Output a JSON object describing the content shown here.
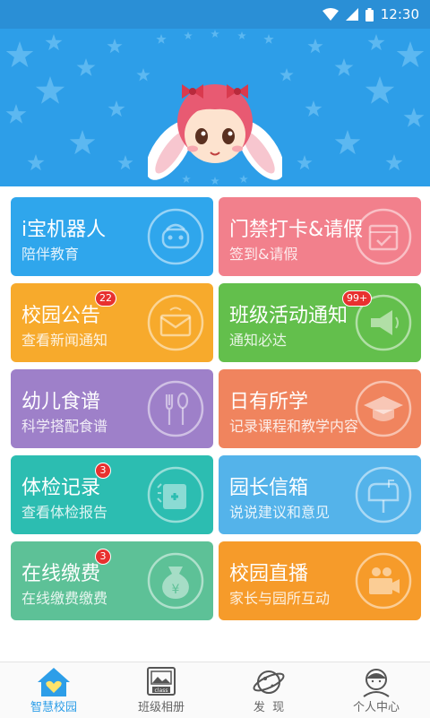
{
  "status_bar": {
    "time": "12:30"
  },
  "tiles": [
    {
      "title": "i宝机器人",
      "subtitle": "陪伴教育",
      "color": "#2fa6ec",
      "icon": "robot-icon",
      "badge": ""
    },
    {
      "title": "门禁打卡&请假",
      "subtitle": "签到&请假",
      "color": "#f2808c",
      "icon": "calendar-check-icon",
      "badge": ""
    },
    {
      "title": "校园公告",
      "subtitle": "查看新闻通知",
      "color": "#f7aa2c",
      "icon": "envelope-icon",
      "badge": "22"
    },
    {
      "title": "班级活动通知",
      "subtitle": "通知必达",
      "color": "#63bf4c",
      "icon": "megaphone-icon",
      "badge": "99+"
    },
    {
      "title": "幼儿食谱",
      "subtitle": "科学搭配食谱",
      "color": "#9e80c9",
      "icon": "fork-spoon-icon",
      "badge": ""
    },
    {
      "title": "日有所学",
      "subtitle": "记录课程和教学内容",
      "color": "#f0845e",
      "icon": "graduation-cap-icon",
      "badge": ""
    },
    {
      "title": "体检记录",
      "subtitle": "查看体检报告",
      "color": "#2cbdb1",
      "icon": "medical-kit-icon",
      "badge": "3"
    },
    {
      "title": "园长信箱",
      "subtitle": "说说建议和意见",
      "color": "#54b3ea",
      "icon": "mailbox-icon",
      "badge": ""
    },
    {
      "title": "在线缴费",
      "subtitle": "在线缴费缴费",
      "color": "#5dc197",
      "icon": "money-bag-icon",
      "badge": "3"
    },
    {
      "title": "校园直播",
      "subtitle": "家长与园所互动",
      "color": "#f69b2a",
      "icon": "video-camera-icon",
      "badge": ""
    }
  ],
  "bottom_nav": [
    {
      "label": "智慧校园",
      "icon": "home-heart-icon",
      "active": true
    },
    {
      "label": "班级相册",
      "icon": "photo-album-icon",
      "active": false
    },
    {
      "label": "发  现",
      "icon": "planet-icon",
      "active": false
    },
    {
      "label": "个人中心",
      "icon": "person-icon",
      "active": false
    }
  ],
  "colors": {
    "accent": "#2d9ee8",
    "hero_bg": "#2d9ee8",
    "badge": "#e8312f",
    "inactive_tab": "#666666"
  }
}
